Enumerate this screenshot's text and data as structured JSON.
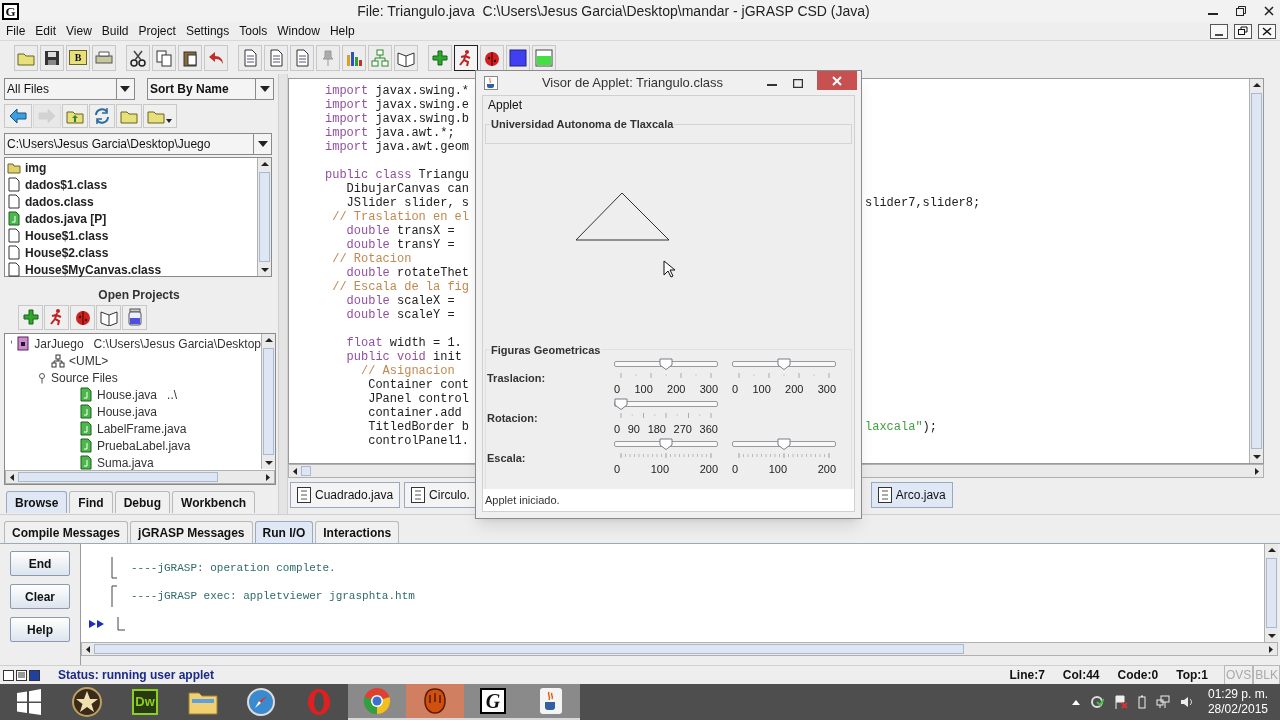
{
  "window": {
    "icon_label": "G",
    "title": "File: Triangulo.java  C:\\Users\\Jesus Garcia\\Desktop\\mandar - jGRASP CSD (Java)"
  },
  "menu": [
    "File",
    "Edit",
    "View",
    "Build",
    "Project",
    "Settings",
    "Tools",
    "Window",
    "Help"
  ],
  "toolbar": [
    {
      "kind": "open",
      "pressed": false
    },
    {
      "kind": "save",
      "pressed": false
    },
    {
      "kind": "b",
      "label": "B",
      "pressed": false
    },
    {
      "kind": "print",
      "pressed": false
    },
    {
      "kind": "cut",
      "pressed": false
    },
    {
      "kind": "copy",
      "pressed": false
    },
    {
      "kind": "paste",
      "pressed": false
    },
    {
      "kind": "undo",
      "pressed": false
    },
    {
      "kind": "doc",
      "pressed": false
    },
    {
      "kind": "doc",
      "pressed": false
    },
    {
      "kind": "doc",
      "pressed": false
    },
    {
      "kind": "pin",
      "pressed": false
    },
    {
      "kind": "chart",
      "pressed": false
    },
    {
      "kind": "uml",
      "pressed": false
    },
    {
      "kind": "book",
      "pressed": false
    },
    {
      "kind": "add",
      "pressed": false
    },
    {
      "kind": "run",
      "pressed": true
    },
    {
      "kind": "debug",
      "pressed": false
    },
    {
      "kind": "square",
      "pressed": false
    },
    {
      "kind": "fill",
      "pressed": false
    }
  ],
  "browser": {
    "filter": "All Files",
    "sort": "Sort By Name",
    "nav": [
      {
        "kind": "back",
        "disabled": false
      },
      {
        "kind": "forward",
        "disabled": true
      },
      {
        "kind": "up",
        "disabled": false
      },
      {
        "kind": "refresh",
        "disabled": false
      },
      {
        "kind": "folder",
        "disabled": false
      },
      {
        "kind": "folder-menu",
        "disabled": false
      }
    ],
    "path": "C:\\Users\\Jesus Garcia\\Desktop\\Juego",
    "files": [
      {
        "kind": "folder",
        "name": "img"
      },
      {
        "kind": "class",
        "name": "dados$1.class"
      },
      {
        "kind": "class",
        "name": "dados.class"
      },
      {
        "kind": "java",
        "name": "dados.java [P]"
      },
      {
        "kind": "class",
        "name": "House$1.class"
      },
      {
        "kind": "class",
        "name": "House$2.class"
      },
      {
        "kind": "class",
        "name": "House$MyCanvas.class"
      }
    ]
  },
  "projects": {
    "title": "Open Projects",
    "tools": [
      {
        "kind": "add"
      },
      {
        "kind": "run"
      },
      {
        "kind": "debug"
      },
      {
        "kind": "book"
      },
      {
        "kind": "jar"
      }
    ],
    "tree": [
      {
        "kind": "project",
        "name": "JarJuego",
        "note": "C:\\Users\\Jesus Garcia\\Desktop",
        "expanded": true,
        "children": [
          {
            "kind": "uml",
            "name": "<UML>"
          },
          {
            "kind": "group",
            "name": "Source Files",
            "expanded": true,
            "children": [
              {
                "kind": "java",
                "name": "House.java",
                "note": "..\\"
              },
              {
                "kind": "java",
                "name": "House.java"
              },
              {
                "kind": "java",
                "name": "LabelFrame.java"
              },
              {
                "kind": "java",
                "name": "PruebaLabel.java"
              },
              {
                "kind": "java",
                "name": "Suma.java"
              }
            ]
          }
        ]
      }
    ]
  },
  "browser_tabs": [
    {
      "label": "Browse",
      "selected": true
    },
    {
      "label": "Find",
      "selected": false
    },
    {
      "label": "Debug",
      "selected": false
    },
    {
      "label": "Workbench",
      "selected": false
    }
  ],
  "editor": {
    "lines": [
      {
        "segments": [
          {
            "kind": "keyword",
            "text": "import"
          },
          {
            "kind": "plain",
            "text": " javax.swing.*"
          }
        ]
      },
      {
        "segments": [
          {
            "kind": "keyword",
            "text": "import"
          },
          {
            "kind": "plain",
            "text": " javax.swing.e"
          }
        ]
      },
      {
        "segments": [
          {
            "kind": "keyword",
            "text": "import"
          },
          {
            "kind": "plain",
            "text": " javax.swing.b"
          }
        ]
      },
      {
        "segments": [
          {
            "kind": "keyword",
            "text": "import"
          },
          {
            "kind": "plain",
            "text": " java.awt.*;"
          }
        ]
      },
      {
        "segments": [
          {
            "kind": "keyword",
            "text": "import"
          },
          {
            "kind": "plain",
            "text": " java.awt.geom"
          }
        ]
      },
      {
        "kind": "blank"
      },
      {
        "segments": [
          {
            "kind": "keyword",
            "text": "public class"
          },
          {
            "kind": "plain",
            "text": " Triangu"
          }
        ]
      },
      {
        "segments": [
          {
            "kind": "plain",
            "text": "   DibujarCanvas can"
          }
        ]
      },
      {
        "segments": [
          {
            "kind": "plain",
            "text": "   JSlider slider, s"
          }
        ],
        "tail": [
          {
            "kind": "plain",
            "text": "slider7,slider8;"
          }
        ]
      },
      {
        "segments": [
          {
            "kind": "comment",
            "text": " // Traslation en el"
          }
        ]
      },
      {
        "segments": [
          {
            "kind": "keyword",
            "text": "   double"
          },
          {
            "kind": "plain",
            "text": " transX = "
          }
        ]
      },
      {
        "segments": [
          {
            "kind": "keyword",
            "text": "   double"
          },
          {
            "kind": "plain",
            "text": " transY = "
          }
        ]
      },
      {
        "segments": [
          {
            "kind": "comment",
            "text": " // Rotacion"
          }
        ]
      },
      {
        "segments": [
          {
            "kind": "keyword",
            "text": "   double"
          },
          {
            "kind": "plain",
            "text": " rotateThet"
          }
        ]
      },
      {
        "segments": [
          {
            "kind": "comment",
            "text": " // Escala de la fig"
          }
        ]
      },
      {
        "segments": [
          {
            "kind": "keyword",
            "text": "   double"
          },
          {
            "kind": "plain",
            "text": " scaleX = "
          }
        ]
      },
      {
        "segments": [
          {
            "kind": "keyword",
            "text": "   double"
          },
          {
            "kind": "plain",
            "text": " scaleY = "
          }
        ]
      },
      {
        "kind": "blank"
      },
      {
        "segments": [
          {
            "kind": "keyword",
            "text": "   float"
          },
          {
            "kind": "plain",
            "text": " width = 1."
          }
        ]
      },
      {
        "segments": [
          {
            "kind": "keyword",
            "text": "   public void"
          },
          {
            "kind": "plain",
            "text": " init"
          }
        ]
      },
      {
        "segments": [
          {
            "kind": "comment",
            "text": "     // Asignacion"
          }
        ]
      },
      {
        "segments": [
          {
            "kind": "plain",
            "text": "      Container cont"
          }
        ]
      },
      {
        "segments": [
          {
            "kind": "plain",
            "text": "      JPanel control"
          }
        ]
      },
      {
        "segments": [
          {
            "kind": "plain",
            "text": "      container.add"
          }
        ]
      },
      {
        "segments": [
          {
            "kind": "plain",
            "text": "      TitledBorder b"
          }
        ],
        "tail": [
          {
            "kind": "string",
            "text": "laxcala\""
          },
          {
            "kind": "plain",
            "text": ");"
          }
        ]
      },
      {
        "segments": [
          {
            "kind": "plain",
            "text": "      controlPanel1."
          }
        ]
      }
    ],
    "tabs": [
      {
        "label": "Cuadrado.java",
        "selected": false
      },
      {
        "label": "Circulo.",
        "selected": false
      },
      {
        "label": "Arco.java",
        "selected": true
      }
    ]
  },
  "applet": {
    "title": "Visor de Applet: Triangulo.class",
    "menu": "Applet",
    "header": "Universidad Autonoma de Tlaxcala",
    "controls_title": "Figuras Geometricas",
    "rows": [
      {
        "label": "Traslacion:",
        "sliders": [
          {
            "level": 0.5,
            "minor_ticks": false,
            "ticks": [
              "0",
              "100",
              "200",
              "300"
            ]
          },
          {
            "level": 0.5,
            "minor_ticks": false,
            "ticks": [
              "0",
              "100",
              "200",
              "300"
            ]
          }
        ]
      },
      {
        "label": "Rotacion:",
        "sliders": [
          {
            "level": 0,
            "minor_ticks": false,
            "ticks": [
              "0",
              "90",
              "180",
              "270",
              "360"
            ]
          }
        ]
      },
      {
        "label": "Escala:",
        "sliders": [
          {
            "level": 0.5,
            "minor_ticks": true,
            "ticks": [
              "0",
              "100",
              "200"
            ]
          },
          {
            "level": 0.5,
            "minor_ticks": true,
            "ticks": [
              "0",
              "100",
              "200"
            ]
          }
        ]
      }
    ],
    "status": "Applet iniciado."
  },
  "messages": {
    "tabs": [
      {
        "label": "Compile Messages",
        "selected": false
      },
      {
        "label": "jGRASP Messages",
        "selected": false
      },
      {
        "label": "Run I/O",
        "selected": true
      },
      {
        "label": "Interactions",
        "selected": false
      }
    ],
    "buttons": [
      "End",
      "Clear",
      "Help"
    ],
    "lines": [
      {
        "kind": "end",
        "text": "----jGRASP: operation complete."
      },
      {
        "kind": "start",
        "text": "----jGRASP exec: appletviewer jgrasphta.htm"
      },
      {
        "kind": "prompt"
      }
    ]
  },
  "status": {
    "text": "Status: running user applet",
    "fields": [
      "Line:7",
      "Col:44",
      "Code:0",
      "Top:1"
    ],
    "modes": [
      {
        "label": "OVS",
        "on": false
      },
      {
        "label": "BLK",
        "on": false
      }
    ]
  },
  "taskbar": {
    "apps": [
      {
        "kind": "start",
        "running": false
      },
      {
        "kind": "star",
        "running": false
      },
      {
        "kind": "dw",
        "label": "Dw",
        "running": false
      },
      {
        "kind": "folder",
        "running": false
      },
      {
        "kind": "compass",
        "running": false
      },
      {
        "kind": "opera",
        "running": false
      },
      {
        "kind": "chrome",
        "running": true
      },
      {
        "kind": "glove",
        "running": true,
        "selected": true
      },
      {
        "kind": "jgrasp",
        "label": "G",
        "running": true
      },
      {
        "kind": "java",
        "running": true
      }
    ],
    "clock": {
      "time": "01:29 p. m.",
      "date": "28/02/2015"
    }
  }
}
